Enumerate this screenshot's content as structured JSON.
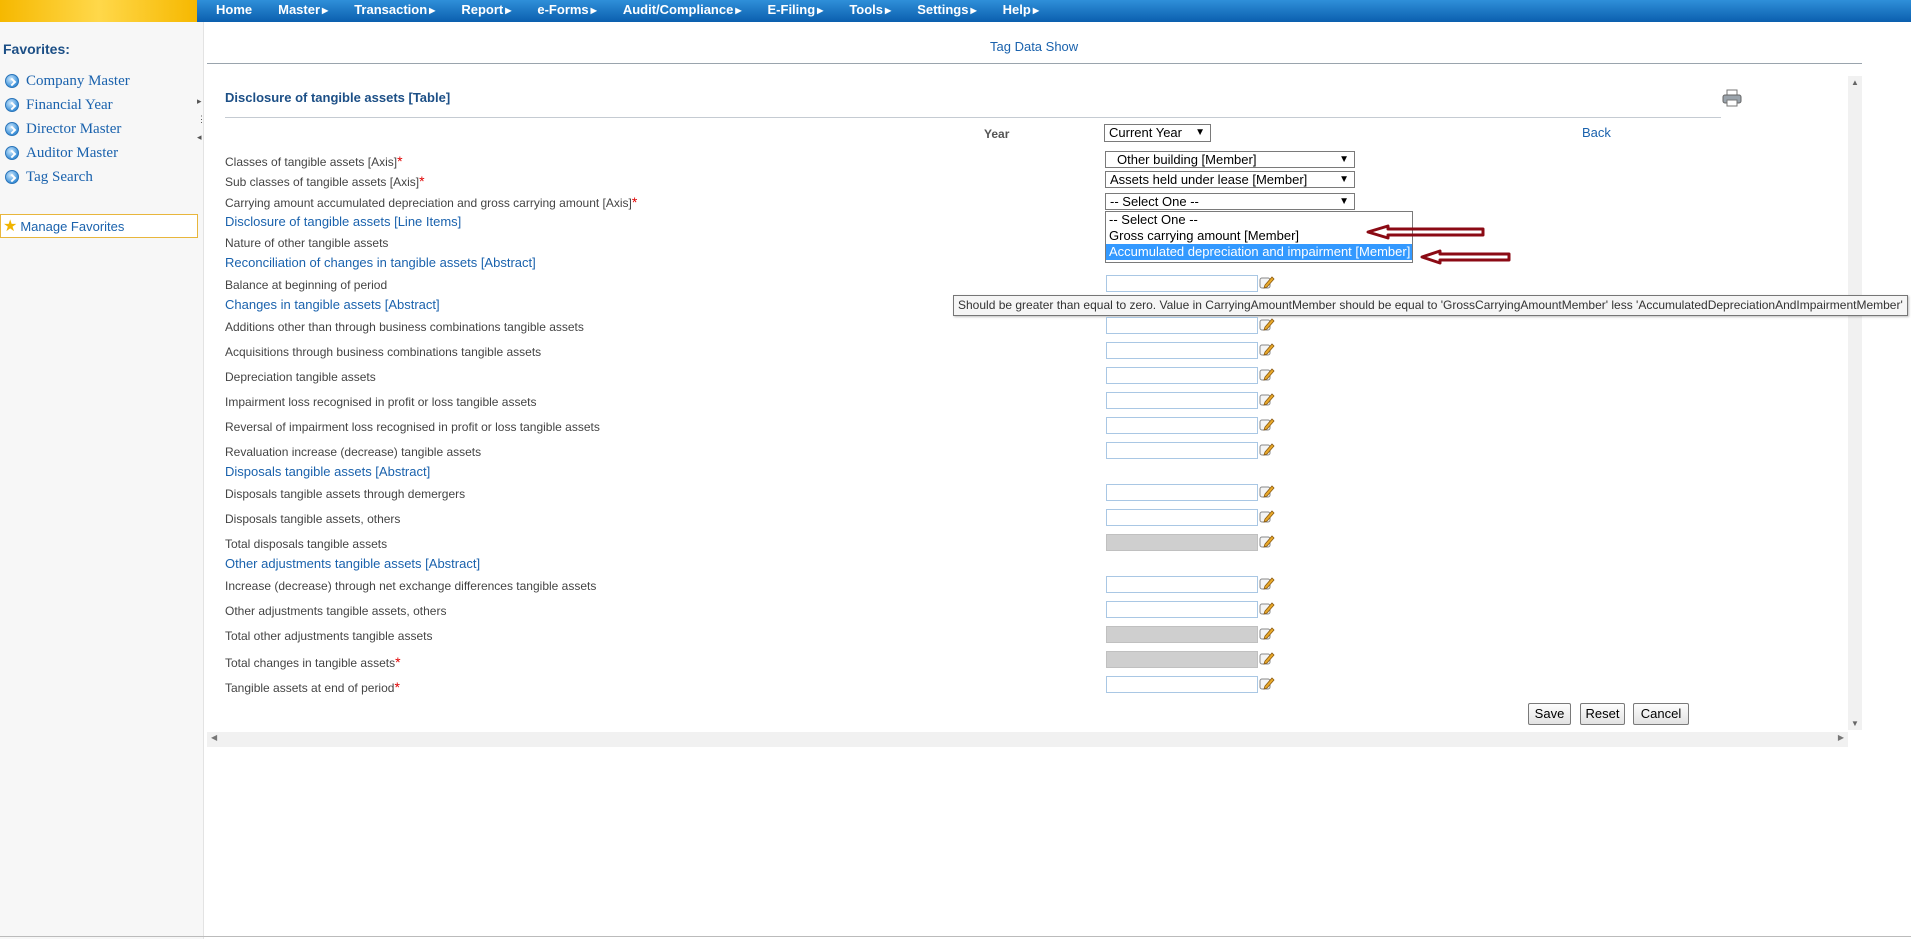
{
  "menu": {
    "items": [
      {
        "label": "Home",
        "caret": false
      },
      {
        "label": "Master",
        "caret": true
      },
      {
        "label": "Transaction",
        "caret": true
      },
      {
        "label": "Report",
        "caret": true
      },
      {
        "label": "e-Forms",
        "caret": true
      },
      {
        "label": "Audit/Compliance",
        "caret": true
      },
      {
        "label": "E-Filing",
        "caret": true
      },
      {
        "label": "Tools",
        "caret": true
      },
      {
        "label": "Settings",
        "caret": true
      },
      {
        "label": "Help",
        "caret": true
      }
    ]
  },
  "sidebar": {
    "title": "Favorites:",
    "items": [
      "Company Master",
      "Financial Year",
      "Director Master",
      "Auditor Master",
      "Tag Search"
    ],
    "manage": "Manage Favorites"
  },
  "header": {
    "title": "Tag Data Show"
  },
  "form": {
    "table_title": "Disclosure of tangible assets [Table]",
    "year_label": "Year",
    "year_value": "Current Year",
    "back": "Back",
    "classes_label": "Classes of tangible assets [Axis]",
    "classes_value": "Other building [Member]",
    "subclasses_label": "Sub classes of tangible assets [Axis]",
    "subclasses_value": "Assets held under lease [Member]",
    "carrying_label": "Carrying amount accumulated depreciation and gross carrying amount [Axis]",
    "carrying_value": "-- Select One --",
    "dropdown_options": [
      "-- Select One --",
      "Gross carrying amount [Member]",
      "Accumulated depreciation and impairment [Member]"
    ],
    "line_items": "Disclosure of tangible assets [Line Items]",
    "nature": "Nature of other tangible assets",
    "reconciliation": "Reconciliation of changes in tangible assets [Abstract]",
    "balance": "Balance at beginning of period",
    "changes": "Changes in tangible assets [Abstract]",
    "tooltip": "Should be greater than equal to zero. Value in  CarryingAmountMember should be equal to 'GrossCarryingAmountMember' less 'AccumulatedDepreciationAndImpairmentMember'",
    "rows": {
      "additions": "Additions other than through business combinations tangible assets",
      "acquisitions": "Acquisitions through business combinations tangible assets",
      "depreciation": "Depreciation tangible assets",
      "impairment": "Impairment loss recognised in profit or loss tangible assets",
      "reversal": "Reversal of impairment loss recognised in profit or loss tangible assets",
      "revaluation": "Revaluation increase (decrease) tangible assets",
      "disposals_abstract": "Disposals tangible assets [Abstract]",
      "disposals_demergers": "Disposals tangible assets through demergers",
      "disposals_others": "Disposals tangible assets, others",
      "total_disposals": "Total disposals tangible assets",
      "other_adj_abstract": "Other adjustments tangible assets [Abstract]",
      "exchange": "Increase (decrease) through net exchange differences tangible assets",
      "other_adj_others": "Other adjustments tangible assets, others",
      "total_other_adj": "Total other adjustments tangible assets",
      "total_changes": "Total changes in tangible assets",
      "end_period": "Tangible assets at end of period"
    },
    "buttons": {
      "save": "Save",
      "reset": "Reset",
      "cancel": "Cancel"
    }
  },
  "colors": {
    "menu_bar": "#0b5fae",
    "logo_strip": "#f6b800",
    "link": "#1a62ad",
    "required": "#e00000",
    "annotation_arrow": "#8b0a14",
    "selected_option": "#3399ff"
  }
}
